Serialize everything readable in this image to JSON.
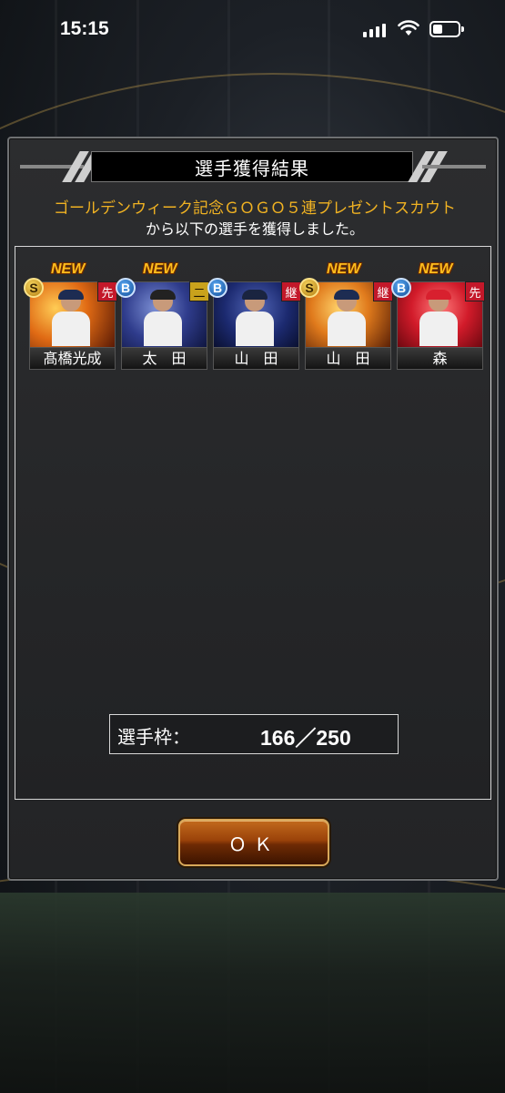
{
  "status_bar": {
    "time": "15:15"
  },
  "dialog": {
    "title": "選手獲得結果",
    "subtitle_line1": "ゴールデンウィーク記念ＧＯＧＯ５連プレゼントスカウト",
    "subtitle_line2": "から以下の選手を獲得しました。",
    "new_label": "NEW",
    "players": [
      {
        "name": "髙橋光成",
        "rank": "S",
        "position": "先",
        "is_new": true,
        "position_color": "#c3182a"
      },
      {
        "name": "太　田",
        "rank": "B",
        "position": "二",
        "is_new": true,
        "position_color": "#c9a21c"
      },
      {
        "name": "山　田",
        "rank": "B",
        "position": "継",
        "is_new": false,
        "position_color": "#c3182a"
      },
      {
        "name": "山　田",
        "rank": "S",
        "position": "継",
        "is_new": true,
        "position_color": "#c3182a"
      },
      {
        "name": "森",
        "rank": "B",
        "position": "先",
        "is_new": true,
        "position_color": "#c3182a"
      }
    ],
    "roster_slots": {
      "label": "選手枠：",
      "value": "166／250"
    },
    "ok_button_label": "ＯＫ"
  },
  "colors": {
    "accent_gold": "#f0b222",
    "button_orange": "#9a4209",
    "rank_s": "#d6a52a",
    "rank_b": "#2a77d0"
  }
}
